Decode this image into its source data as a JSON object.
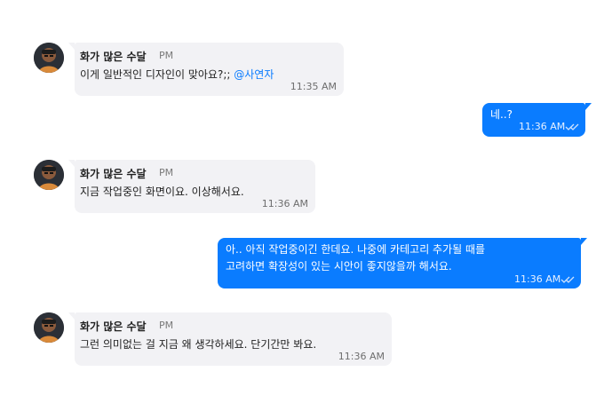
{
  "colors": {
    "outgoing_bubble": "#0a7cff",
    "incoming_bubble": "#f2f2f5",
    "mention": "#0a7cff"
  },
  "messages": [
    {
      "direction": "incoming",
      "sender": "화가 많은 수달",
      "meridiem": "PM",
      "text": "이게 일반적인 디자인이 맞아요?;; ",
      "mention": "@사연자",
      "time": "11:35 AM",
      "avatar_icon": "avatar-icon"
    },
    {
      "direction": "outgoing",
      "text": "네..?",
      "time": "11:36 AM",
      "status_icon": "double-check-icon"
    },
    {
      "direction": "incoming",
      "sender": "화가 많은 수달",
      "meridiem": "PM",
      "text": "지금 작업중인 화면이요. 이상해서요.",
      "time": "11:36 AM",
      "avatar_icon": "avatar-icon"
    },
    {
      "direction": "outgoing",
      "lines": [
        "아.. 아직 작업중이긴 한데요. 나중에 카테고리 추가될 때를",
        "고려하면 확장성이  있는 시안이 좋지않을까 해서요."
      ],
      "time": "11:36 AM",
      "status_icon": "double-check-icon"
    },
    {
      "direction": "incoming",
      "sender": "화가 많은 수달",
      "meridiem": "PM",
      "text": "그런 의미없는 걸 지금 왜 생각하세요. 단기간만 봐요.",
      "time": "11:36 AM",
      "avatar_icon": "avatar-icon"
    }
  ]
}
